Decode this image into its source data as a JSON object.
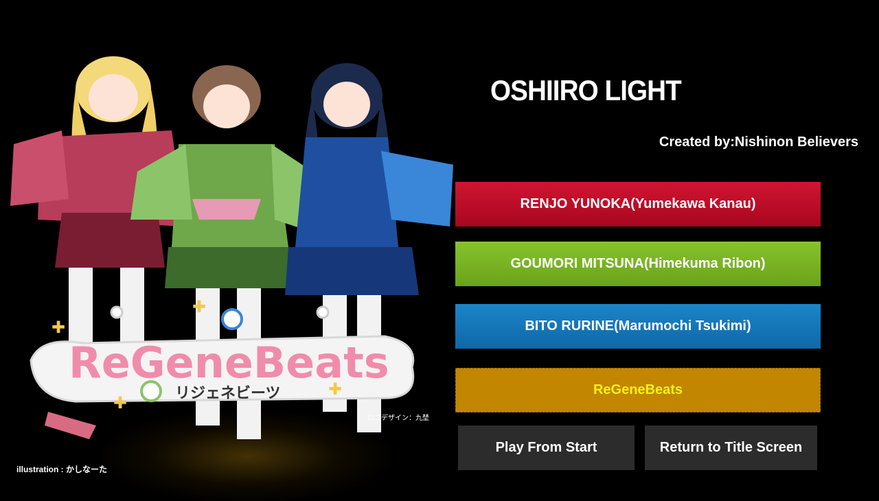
{
  "song": {
    "title": "OSHIIRO LIGHT",
    "creator": "Created by:Nishinon Believers"
  },
  "characters": [
    {
      "label": "RENJO YUNOKA(Yumekawa Kanau)",
      "color": "#c10c28"
    },
    {
      "label": "GOUMORI MITSUNA(Himekuma Ribon)",
      "color": "#78b526"
    },
    {
      "label": "BITO RURINE(Marumochi Tsukimi)",
      "color": "#1577b8"
    },
    {
      "label": "ReGeneBeats",
      "color": "#c28600"
    }
  ],
  "actions": {
    "play_label": "Play From Start",
    "return_label": "Return to Title Screen"
  },
  "artwork": {
    "logo_text": "ReGeneBeats",
    "logo_kana": "リジェネビーツ",
    "logo_credit": "ロゴデザイン：九埜",
    "illustration_credit": "illustration : かしなーた"
  }
}
